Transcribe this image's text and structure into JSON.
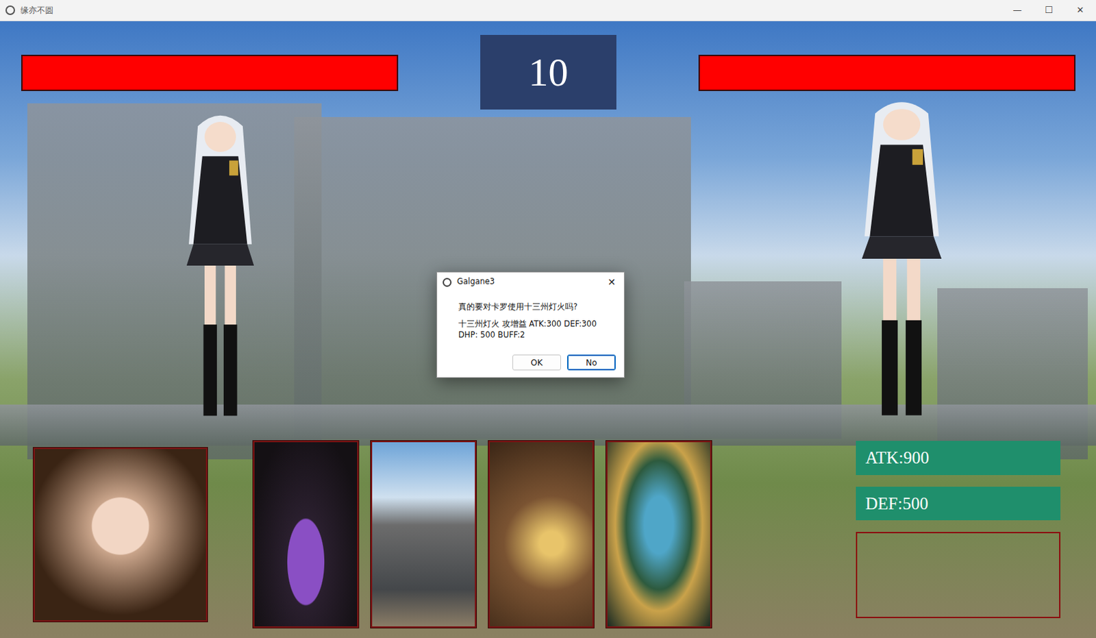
{
  "window": {
    "title": "缘亦不圆",
    "controls": [
      "—",
      "☐",
      "✕"
    ]
  },
  "player": {
    "hp_level": 1.0
  },
  "enemy": {
    "hp_level": 1.0
  },
  "timer": "10",
  "hand": [
    {
      "kind": "hero"
    },
    {
      "kind": "item"
    },
    {
      "kind": "item"
    },
    {
      "kind": "item"
    },
    {
      "kind": "item"
    }
  ],
  "stats": [
    {
      "label": "ATK:900"
    },
    {
      "label": "DEF:500"
    }
  ],
  "dialog": {
    "title": "Galgane3",
    "close": "✕",
    "question": "真的要对卡罗使用十三州灯火吗?",
    "detail": "十三州灯火 攻增益 ATK:300 DEF:300 DHP: 500 BUFF:2",
    "buttons": [
      {
        "label": "OK",
        "selected": false
      },
      {
        "label": "No",
        "selected": true
      }
    ]
  }
}
